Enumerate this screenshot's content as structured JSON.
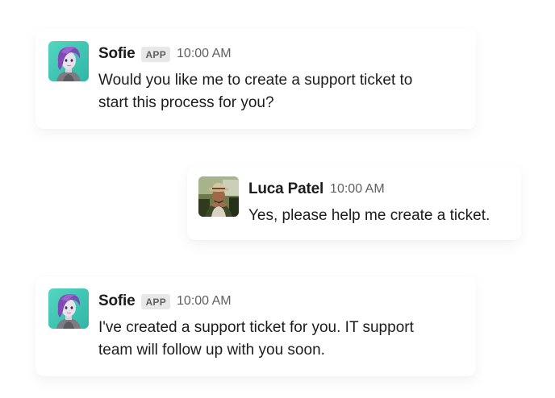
{
  "messages": [
    {
      "sender": "Sofie",
      "badge": "APP",
      "time": "10:00 AM",
      "text_lines": [
        "Would you like me to create a support ticket to",
        "start this process for you?"
      ],
      "avatar": "sofie-avatar-icon"
    },
    {
      "sender": "Luca Patel",
      "time": "10:00 AM",
      "text_lines": [
        "Yes, please help me create a ticket."
      ],
      "avatar": "luca-photo-avatar"
    },
    {
      "sender": "Sofie",
      "badge": "APP",
      "time": "10:00 AM",
      "text_lines": [
        "I've created a support ticket for you. IT support",
        "team will follow up with you soon."
      ],
      "avatar": "sofie-avatar-icon"
    }
  ],
  "colors": {
    "background": "#ffffff",
    "avatar_teal": "#3ec7b3",
    "avatar_purple": "#7c4bb0",
    "badge_bg": "#e8e8e8",
    "muted_text": "#616061"
  }
}
